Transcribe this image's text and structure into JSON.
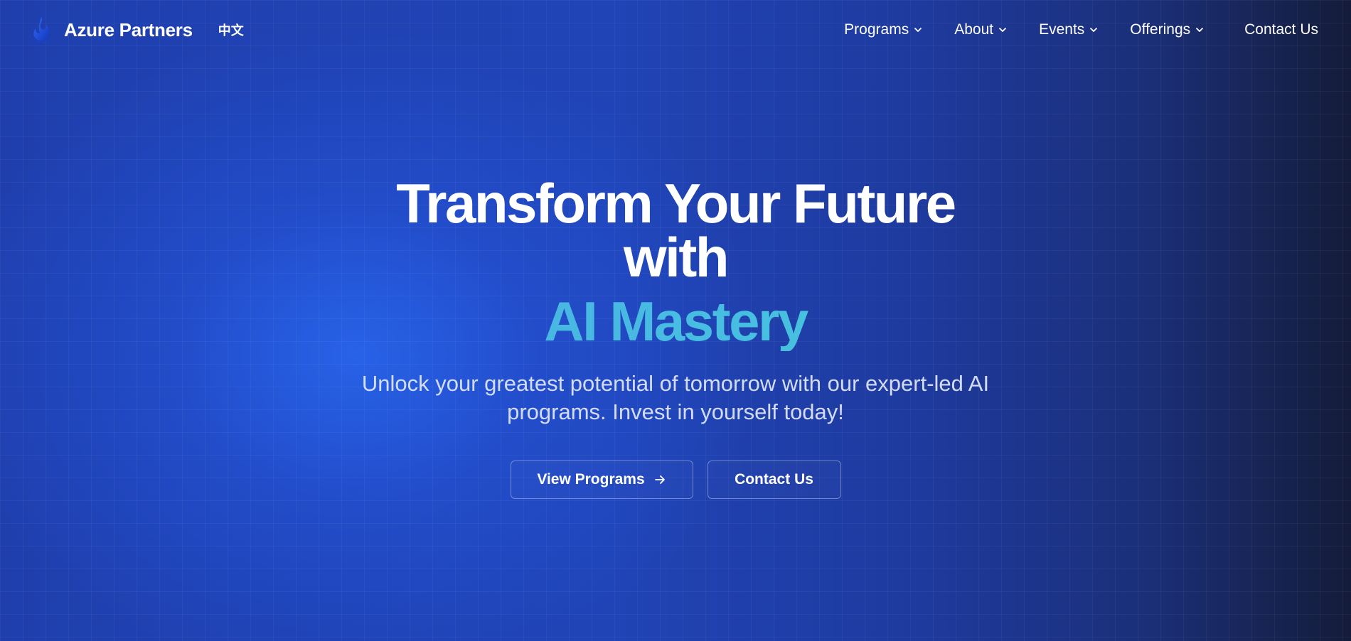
{
  "brand": {
    "name": "Azure Partners",
    "logo_icon": "azure-flame-logo-icon",
    "language_toggle": "中文"
  },
  "nav": {
    "items": [
      {
        "label": "Programs",
        "icon": "chevron-down-icon"
      },
      {
        "label": "About",
        "icon": "chevron-down-icon"
      },
      {
        "label": "Events",
        "icon": "chevron-down-icon"
      },
      {
        "label": "Offerings",
        "icon": "chevron-down-icon"
      }
    ],
    "contact": "Contact Us"
  },
  "hero": {
    "headline_line1": "Transform Your Future",
    "headline_line2": "with",
    "headline_accent": "AI Mastery",
    "subtitle": "Unlock your greatest potential of tomorrow with our expert-led AI programs. Invest in yourself today!",
    "primary_button": "View Programs",
    "primary_button_icon": "arrow-right-icon",
    "secondary_button": "Contact Us"
  },
  "colors": {
    "background": "#2044b6",
    "background_dark": "#141c3a",
    "accent_start": "#4aa3ea",
    "accent_end": "#3fd0d4",
    "text": "#ffffff"
  }
}
